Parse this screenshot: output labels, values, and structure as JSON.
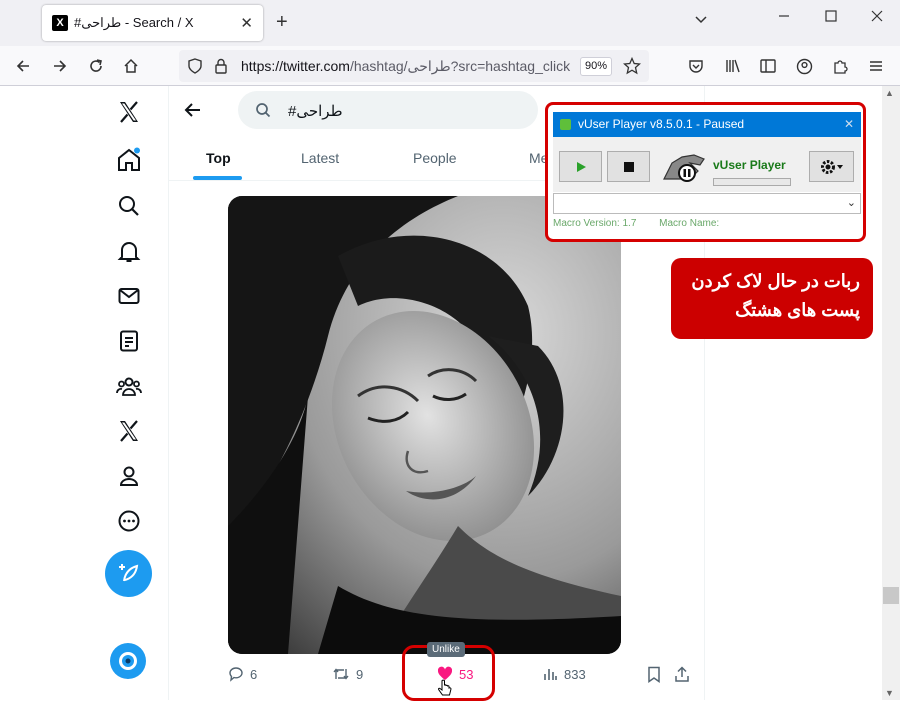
{
  "browser": {
    "tab_title": "#طراحی - Search / X",
    "tab_favicon": "X",
    "url_host": "https://twitter.com",
    "url_rest": "/hashtag/طراحی?src=hashtag_click",
    "zoom": "90%"
  },
  "search": {
    "query": "#طراحی"
  },
  "tabs": [
    "Top",
    "Latest",
    "People",
    "Me"
  ],
  "tweet": {
    "replies": "6",
    "retweets": "9",
    "likes": "53",
    "views": "833",
    "tooltip": "Unlike",
    "like_color": "#f91880"
  },
  "vuser": {
    "title": "vUser Player v8.5.0.1 - Paused",
    "brand": "vUser Player",
    "macro_version_label": "Macro Version: 1.7",
    "macro_name_label": "Macro Name:"
  },
  "callout": {
    "line1": "ربات در حال لاک کردن",
    "line2": "پست های هشتگ"
  },
  "colors": {
    "accent": "#1d9bf0",
    "highlight": "#d50000"
  },
  "icons": {
    "nav": [
      "x-logo-icon",
      "home-icon",
      "search-icon",
      "bell-icon",
      "mail-icon",
      "list-icon",
      "communities-icon",
      "x-premium-icon",
      "profile-icon",
      "more-icon",
      "compose-icon",
      "avatar"
    ]
  }
}
